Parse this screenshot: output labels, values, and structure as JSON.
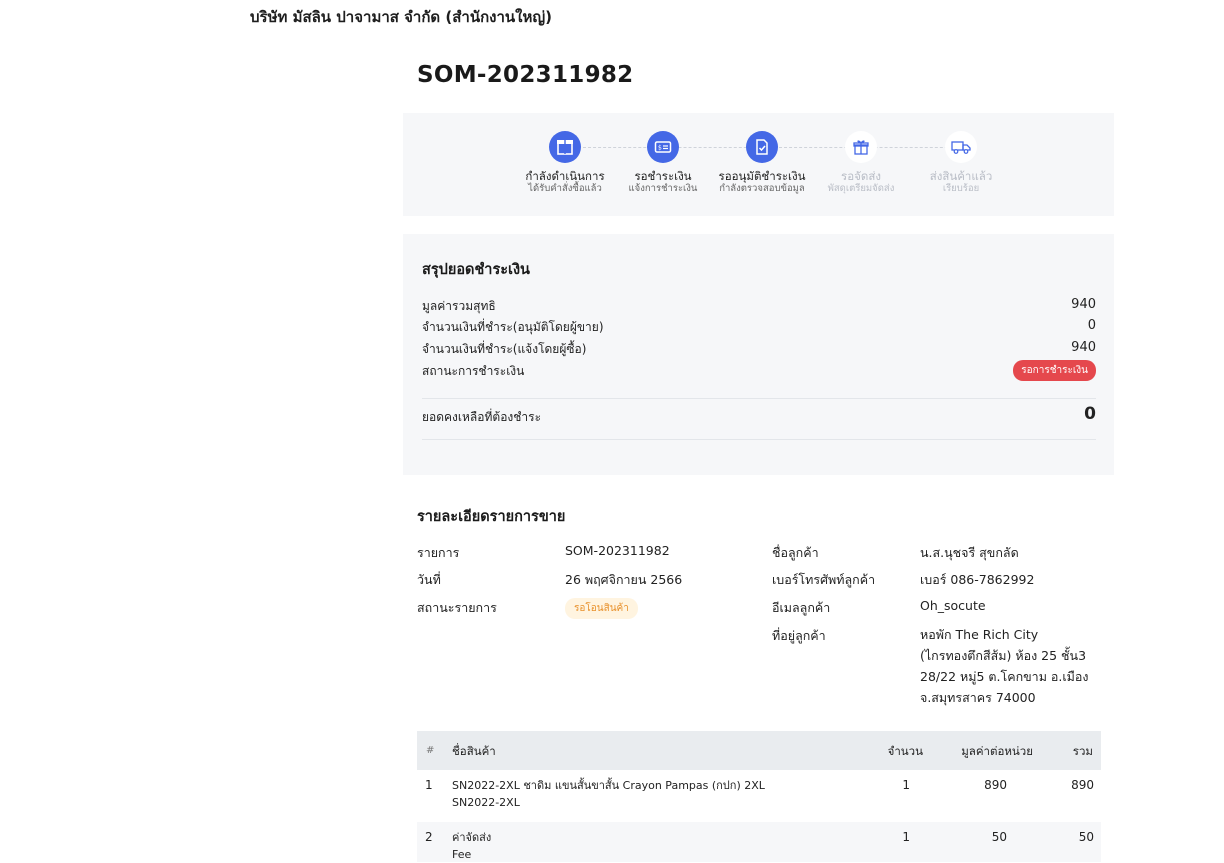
{
  "header": {
    "company": "บริษัท มัสลิน ปาจามาส จำกัด (สำนักงานใหญ่)",
    "order_number": "SOM-202311982"
  },
  "steps": [
    {
      "title": "กำลังดำเนินการ",
      "subtitle": "ได้รับคำสั่งซื้อแล้ว",
      "icon": "box-icon",
      "state": "done"
    },
    {
      "title": "รอชำระเงิน",
      "subtitle": "แจ้งการชำระเงิน",
      "icon": "payment-card-icon",
      "state": "done"
    },
    {
      "title": "รออนุมัติชำระเงิน",
      "subtitle": "กำลังตรวจสอบข้อมูล",
      "icon": "document-check-icon",
      "state": "done"
    },
    {
      "title": "รอจัดส่ง",
      "subtitle": "พัสดุเตรียมจัดส่ง",
      "icon": "gift-icon",
      "state": "todo"
    },
    {
      "title": "ส่งสินค้าแล้ว",
      "subtitle": "เรียบร้อย",
      "icon": "truck-icon",
      "state": "todo"
    }
  ],
  "summary": {
    "title": "สรุปยอดชำระเงิน",
    "rows": [
      {
        "label": "มูลค่ารวมสุทธิ",
        "value": "940"
      },
      {
        "label": "จำนวนเงินที่ชำระ(อนุมัติโดยผู้ขาย)",
        "value": "0"
      },
      {
        "label": "จำนวนเงินที่ชำระ(แจ้งโดยผู้ซื้อ)",
        "value": "940"
      }
    ],
    "status_label": "สถานะการชำระเงิน",
    "status_badge": "รอการชำระเงิน",
    "balance_label": "ยอดคงเหลือที่ต้องชำระ",
    "balance_value": "0"
  },
  "details": {
    "title": "รายละเอียดรายการขาย",
    "item_label": "รายการ",
    "item_value": "SOM-202311982",
    "date_label": "วันที่",
    "date_value": "26 พฤศจิกายน 2566",
    "status_label": "สถานะรายการ",
    "status_badge": "รอโอนสินค้า",
    "customer_name_label": "ชื่อลูกค้า",
    "customer_name": "น.ส.นุชจรี สุขกลัด",
    "phone_label": "เบอร์โทรศัพท์ลูกค้า",
    "phone": "เบอร์ 086-7862992",
    "email_label": "อีเมลลูกค้า",
    "email": "Oh_socute",
    "address_label": "ที่อยู่ลูกค้า",
    "address_lines": [
      "หอพัก The Rich City",
      "(ไกรทองตึกสีส้ม) ห้อง 25 ชั้น3",
      "28/22 หมู่5 ต.โคกขาม อ.เมือง",
      "จ.สมุทรสาคร 74000"
    ]
  },
  "table": {
    "headers": {
      "no": "#",
      "name": "ชื่อสินค้า",
      "qty": "จำนวน",
      "unit_price": "มูลค่าต่อหน่วย",
      "total": "รวม"
    },
    "rows": [
      {
        "no": "1",
        "name": "SN2022-2XL ชาดิม แขนสั้นขาสั้น Crayon Pampas (กปก) 2XL",
        "sku": "SN2022-2XL",
        "qty": "1",
        "unit_price": "890",
        "total": "890"
      },
      {
        "no": "2",
        "name": "ค่าจัดส่ง",
        "sku": "Fee",
        "qty": "1",
        "unit_price": "50",
        "total": "50"
      }
    ]
  },
  "colors": {
    "accent": "#4468e6",
    "badge_red": "#e5484d",
    "badge_orange_bg": "#fff4e0",
    "badge_orange_text": "#e8902a"
  }
}
